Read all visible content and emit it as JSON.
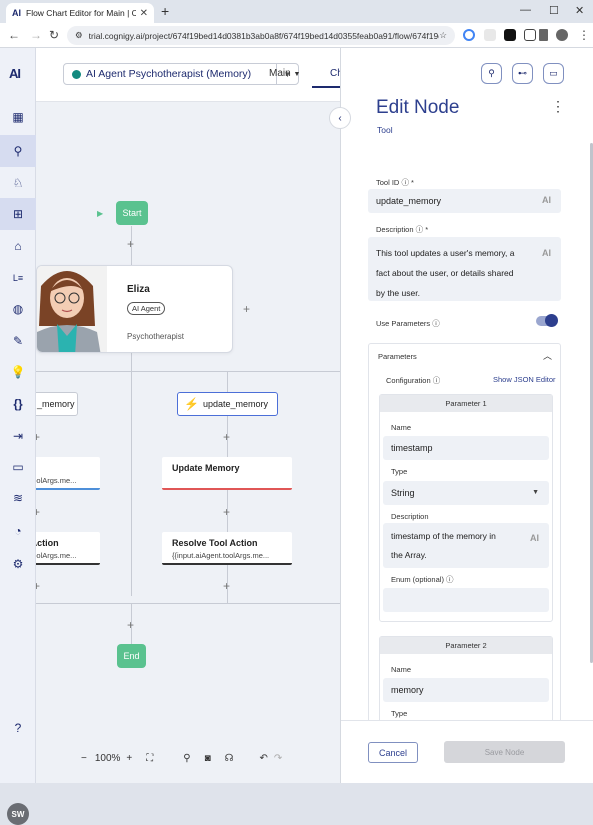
{
  "browser": {
    "tab_title": "Flow Chart Editor for Main | Co",
    "favicon": "AI",
    "url": "trial.cognigy.ai/project/674f19bed14d0381b3ab0a8f/674f19bed14d0355feab0a91/flow/674f19d..."
  },
  "sidebar": {
    "logo": "AI",
    "avatar_initials": "SW",
    "help": "?"
  },
  "topbar": {
    "agent_name": "AI Agent Psychotherapist (Memory)",
    "flow_name": "Main",
    "tab_label": "Ch"
  },
  "canvas": {
    "start_label": "Start",
    "end_label": "End",
    "agent": {
      "name": "Eliza",
      "badge": "AI Agent",
      "role": "Psychotherapist"
    },
    "tool_left": "_memory",
    "tool_right": "update_memory",
    "card_left1_title": "y",
    "card_left1_sub": "t.toolArgs.me...",
    "card_left2_title": "l Action",
    "card_left2_sub": "t.toolArgs.me...",
    "card_right1_title": "Update Memory",
    "card_right2_title": "Resolve Tool Action",
    "card_right2_sub": "{{input.aiAgent.toolArgs.me...",
    "zoom": "100%"
  },
  "panel": {
    "title": "Edit Node",
    "subtitle": "Tool",
    "tool_id_label": "Tool ID",
    "tool_id_value": "update_memory",
    "description_label": "Description",
    "description_value": "This tool updates a user's memory, a fact about the user, or details shared by the user.",
    "use_parameters_label": "Use Parameters",
    "use_parameters": true,
    "parameters_label": "Parameters",
    "configuration_label": "Configuration",
    "show_json": "Show JSON Editor",
    "param1": {
      "header": "Parameter 1",
      "name_label": "Name",
      "name_value": "timestamp",
      "type_label": "Type",
      "type_value": "String",
      "desc_label": "Description",
      "desc_value": "timestamp of the memory in the Array.",
      "enum_label": "Enum (optional)",
      "enum_value": ""
    },
    "param2": {
      "header": "Parameter 2",
      "name_label": "Name",
      "name_value": "memory",
      "type_label": "Type"
    },
    "cancel": "Cancel",
    "save": "Save Node",
    "ai_mark": "AI",
    "required_mark": "*"
  }
}
